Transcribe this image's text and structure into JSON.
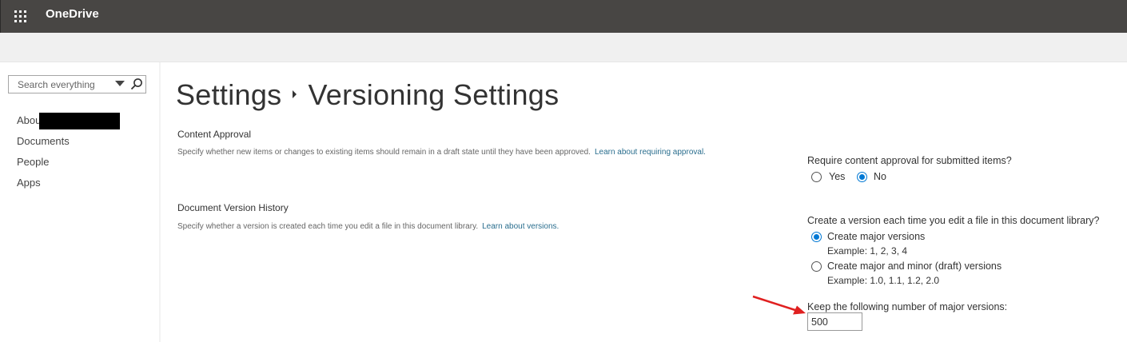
{
  "app": {
    "brand": "OneDrive"
  },
  "search": {
    "placeholder": "Search everything"
  },
  "leftnav": {
    "items": [
      {
        "label": "About"
      },
      {
        "label": "Documents"
      },
      {
        "label": "People"
      },
      {
        "label": "Apps"
      }
    ]
  },
  "page": {
    "breadcrumb_root": "Settings",
    "title": "Versioning Settings"
  },
  "content_approval": {
    "title": "Content Approval",
    "description": "Specify whether new items or changes to existing items should remain in a draft state until they have been approved.",
    "learn_link": "Learn about requiring approval.",
    "question": "Require content approval for submitted items?",
    "options": [
      {
        "label": "Yes",
        "checked": false
      },
      {
        "label": "No",
        "checked": true
      }
    ]
  },
  "version_history": {
    "title": "Document Version History",
    "description": "Specify whether a version is created each time you edit a file in this document library.",
    "learn_link": "Learn about versions.",
    "question": "Create a version each time you edit a file in this document library?",
    "options": [
      {
        "label": "Create major versions",
        "example": "Example: 1, 2, 3, 4",
        "checked": true
      },
      {
        "label": "Create major and minor (draft) versions",
        "example": "Example: 1.0, 1.1, 1.2, 2.0",
        "checked": false
      }
    ],
    "keep_label": "Keep the following number of major versions:",
    "keep_value": "500"
  },
  "colors": {
    "suitebar": "#484644",
    "accent": "#0078d4",
    "link": "#2a6e8e",
    "annotation_arrow": "#e02020"
  },
  "icons": {
    "waffle": "app-launcher-icon",
    "search": "search-icon",
    "dropdown": "chevron-down-icon",
    "arrow": "annotation-arrow-icon"
  }
}
